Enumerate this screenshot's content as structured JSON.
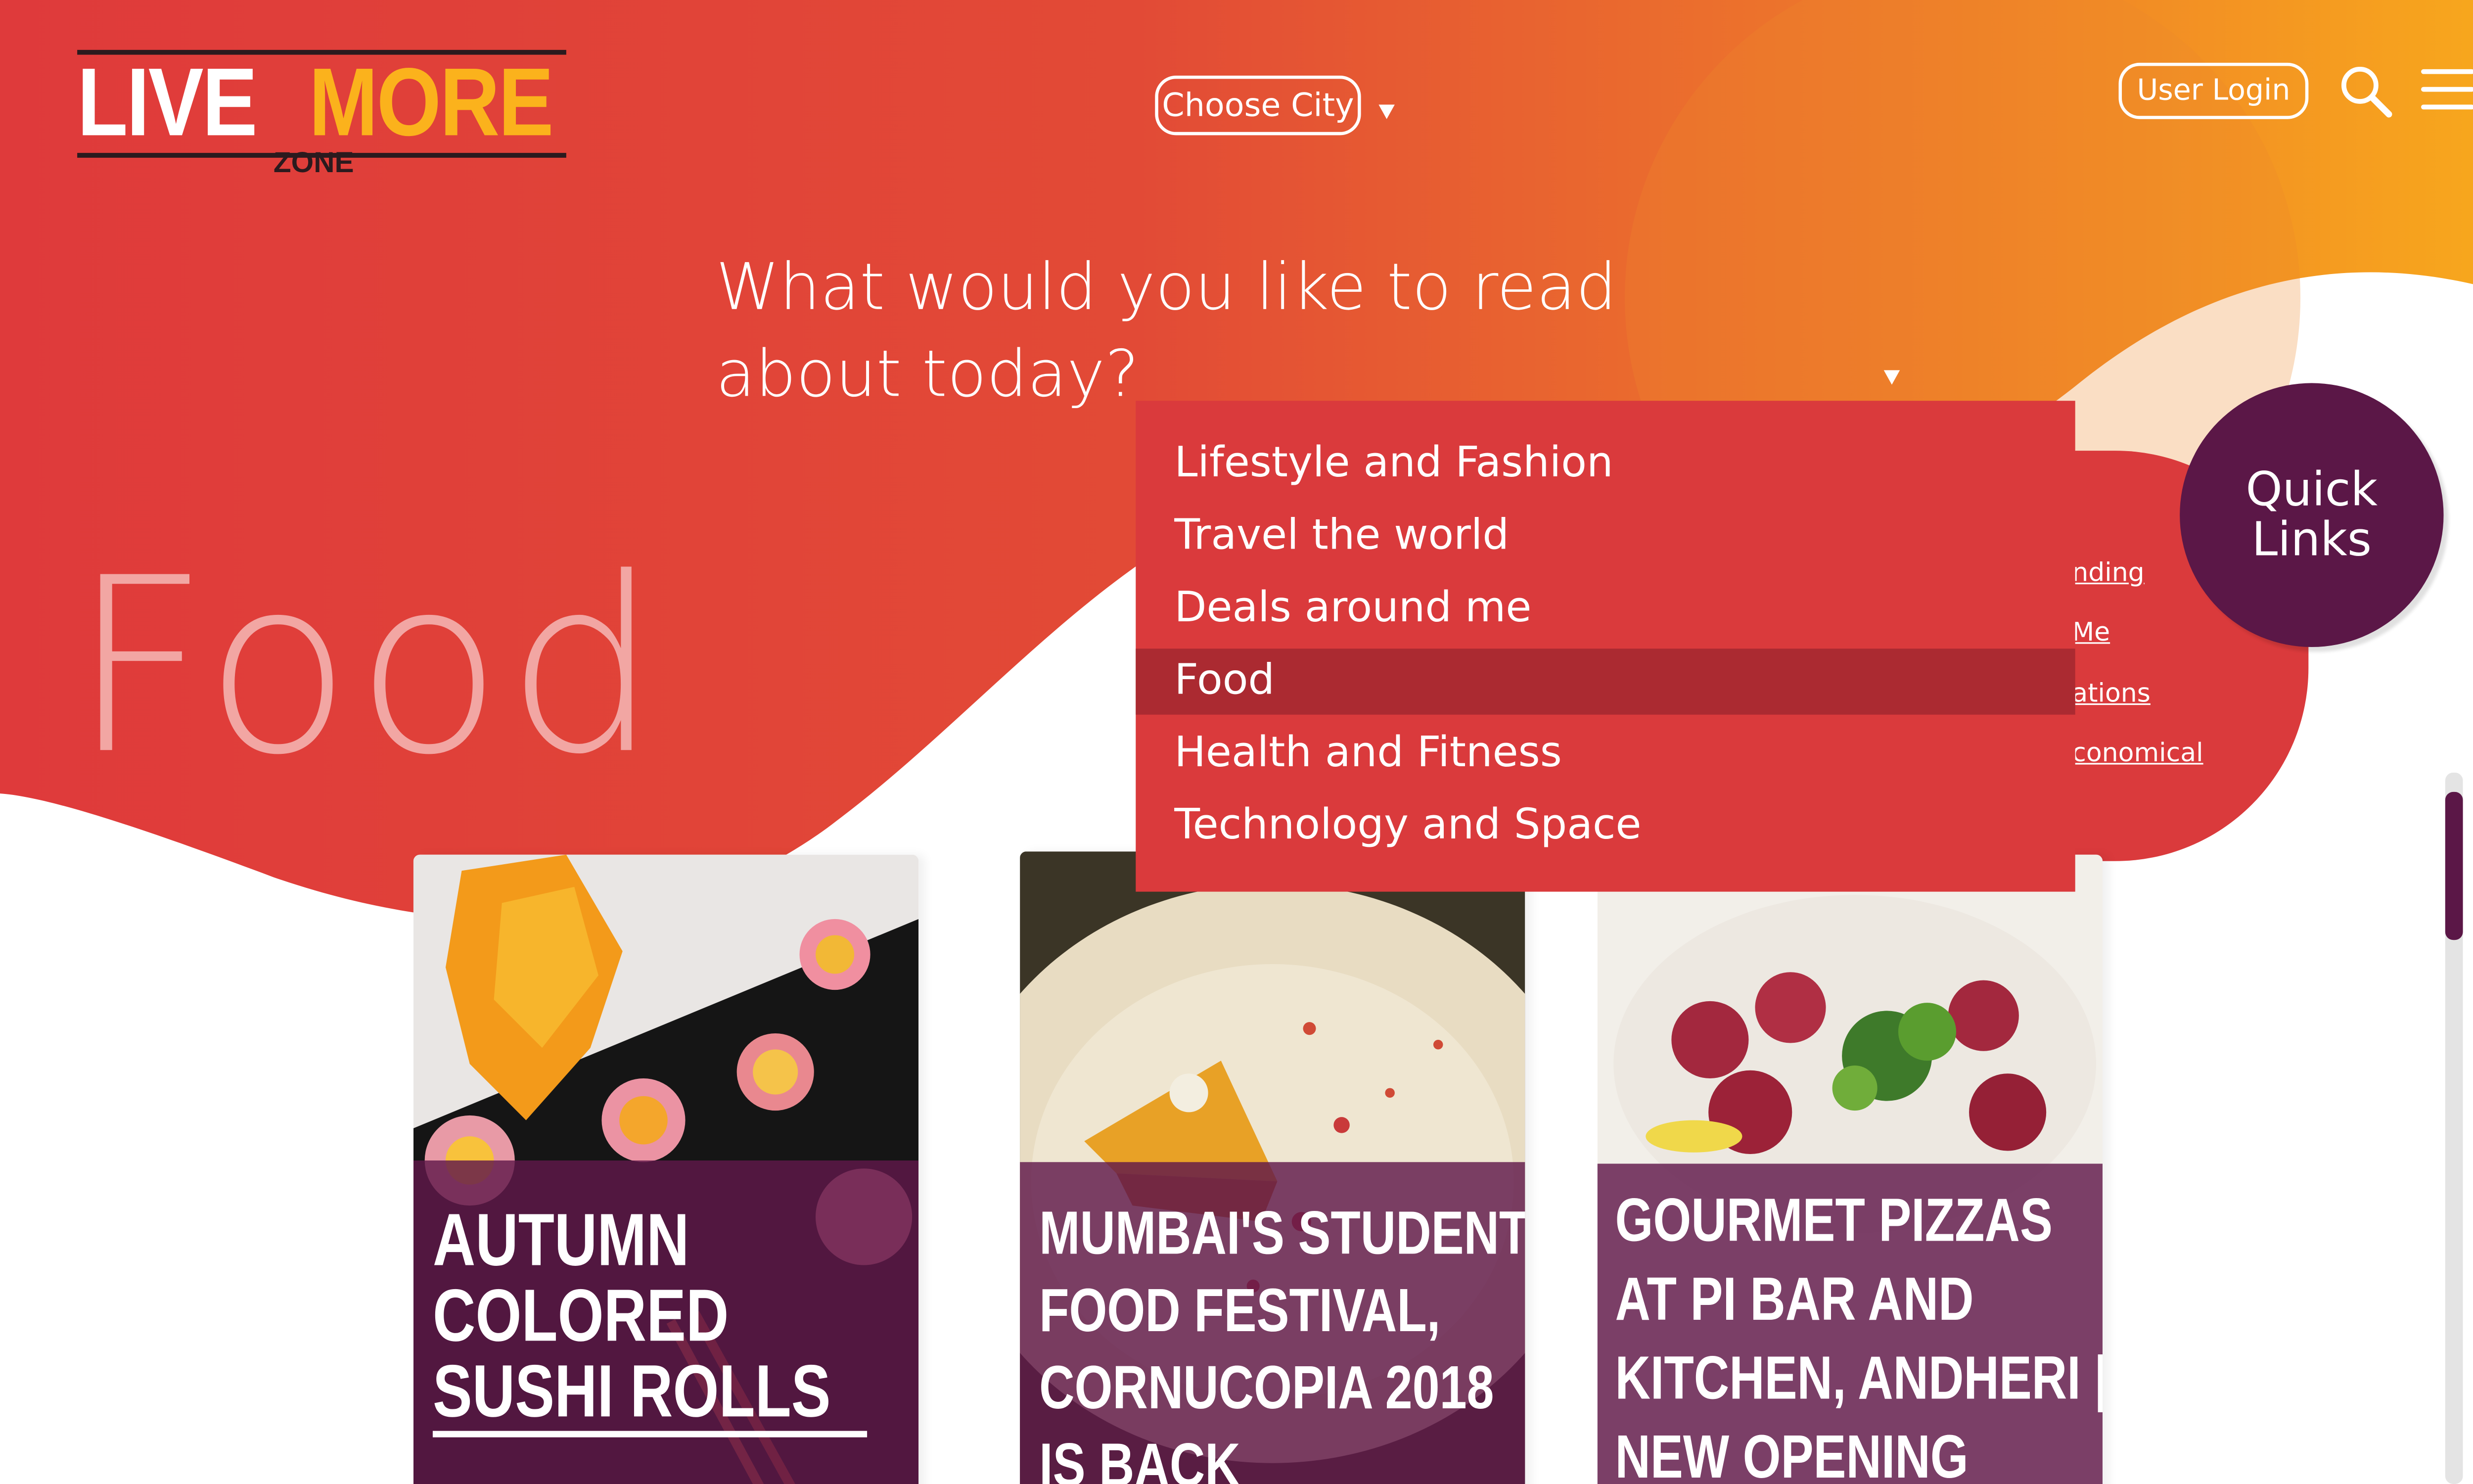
{
  "logo": {
    "word1": "LIVE",
    "word2": "MORE",
    "sub": "ZONE"
  },
  "header": {
    "city_label": "Choose City",
    "login_label": "User Login",
    "search_icon": "search-icon",
    "menu_icon": "hamburger-menu-icon"
  },
  "hero": {
    "question_line1": "What would you like to read",
    "question_line2": "about today?",
    "category_title": "Food"
  },
  "dropdown": {
    "items": [
      "Lifestyle and Fashion",
      "Travel the world",
      "Deals around me",
      "Food",
      "Health and Fitness",
      "Technology and Space"
    ],
    "selected": "Food"
  },
  "quick_links": {
    "title_line1": "Quick",
    "title_line2": "Links",
    "visible_items": [
      "nding",
      "Me",
      "ations",
      "conomical"
    ]
  },
  "cards": [
    {
      "title_lines": [
        "AUTUMN",
        "COLORED",
        "SUSHI ROLLS"
      ]
    },
    {
      "title_lines": [
        "MUMBAI'S STUDENT",
        "FOOD FESTIVAL,",
        "CORNUCOPIA 2018",
        "IS BACK"
      ]
    },
    {
      "title_lines": [
        "GOURMET PIZZAS",
        "AT PI BAR AND",
        "KITCHEN, ANDHERI |",
        "NEW OPENING"
      ]
    }
  ],
  "colors": {
    "brand_red": "#da3a3c",
    "accent_purple": "#5b1747",
    "logo_yellow": "#fbb21c",
    "gradient_orange": "#f7a21b"
  }
}
